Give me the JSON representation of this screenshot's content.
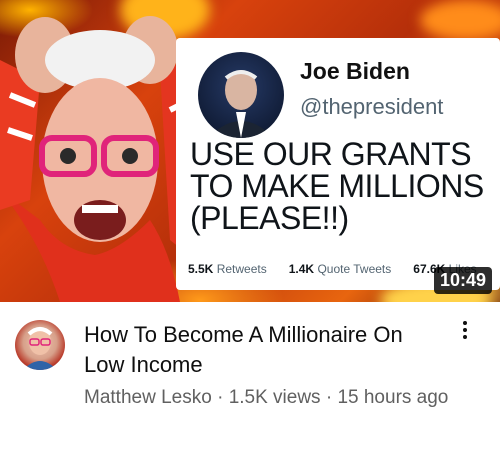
{
  "thumbnail": {
    "tweet": {
      "name": "Joe Biden",
      "handle": "@thepresident",
      "body_lines": [
        "USE OUR GRANTS",
        "TO MAKE MILLIONS",
        "(PLEASE!!)"
      ],
      "retweets_count": "5.5K",
      "retweets_label": "Retweets",
      "quotes_count": "1.4K",
      "quotes_label": "Quote Tweets",
      "likes_count": "67.6K",
      "likes_label": "Likes"
    },
    "duration": "10:49"
  },
  "video": {
    "title": "How To Become A Millionaire On Low Income",
    "channel": "Matthew Lesko",
    "views": "1.5K views",
    "age": "15 hours ago",
    "separator": "·"
  },
  "icons": {
    "more": "more-vert-icon"
  }
}
